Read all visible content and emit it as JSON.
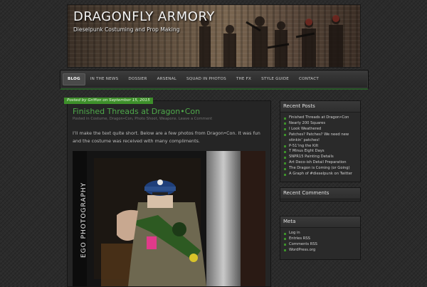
{
  "site": {
    "title": "DRAGONFLY ARMORY",
    "description": "Dieselpunk Costuming and Prop Making"
  },
  "nav": {
    "items": [
      {
        "label": "BLOG",
        "active": true
      },
      {
        "label": "IN THE NEWS",
        "active": false
      },
      {
        "label": "DOSSIER",
        "active": false
      },
      {
        "label": "ARSENAL",
        "active": false
      },
      {
        "label": "SQUAD IN PHOTOS",
        "active": false
      },
      {
        "label": "THE FX",
        "active": false
      },
      {
        "label": "STYLE GUIDE",
        "active": false
      },
      {
        "label": "CONTACT",
        "active": false
      }
    ]
  },
  "post": {
    "meta": "Posted by Griffon on September 15, 2015",
    "title": "Finished Threads at Dragon•Con",
    "categories": "Posted in Costume, Dragon•Con, Photo Shoot, Weapons. Leave a Comment",
    "body": "I’ll make the text quite short. Below are a few photos from Dragon•Con. It was fun and the costume was received with many compliments.",
    "photo_watermark": "EGO PHOTOGRAPHY"
  },
  "sidebar": {
    "recent_posts": {
      "title": "Recent Posts",
      "items": [
        "Finished Threads at Dragon•Con",
        "Nearly 200 Squares",
        "I Look Weathered",
        "Patches? Patches? We need new stinkin’ patches!",
        "P-51’ing the Kilt",
        "T Minus Eight Days",
        "SNPR15 Painting Details",
        "Art Deco-ish Detail Preparation",
        "The Dragon is Coming (or Going)",
        "A Graph of #dieselpunk on Twitter"
      ]
    },
    "recent_comments": {
      "title": "Recent Comments"
    },
    "meta": {
      "title": "Meta",
      "items": [
        "Log in",
        "Entries RSS",
        "Comments RSS",
        "WordPress.org"
      ]
    }
  },
  "colors": {
    "accent_green": "#3d8f2a",
    "title_green": "#4fa84a",
    "background": "#2b2b2b"
  }
}
